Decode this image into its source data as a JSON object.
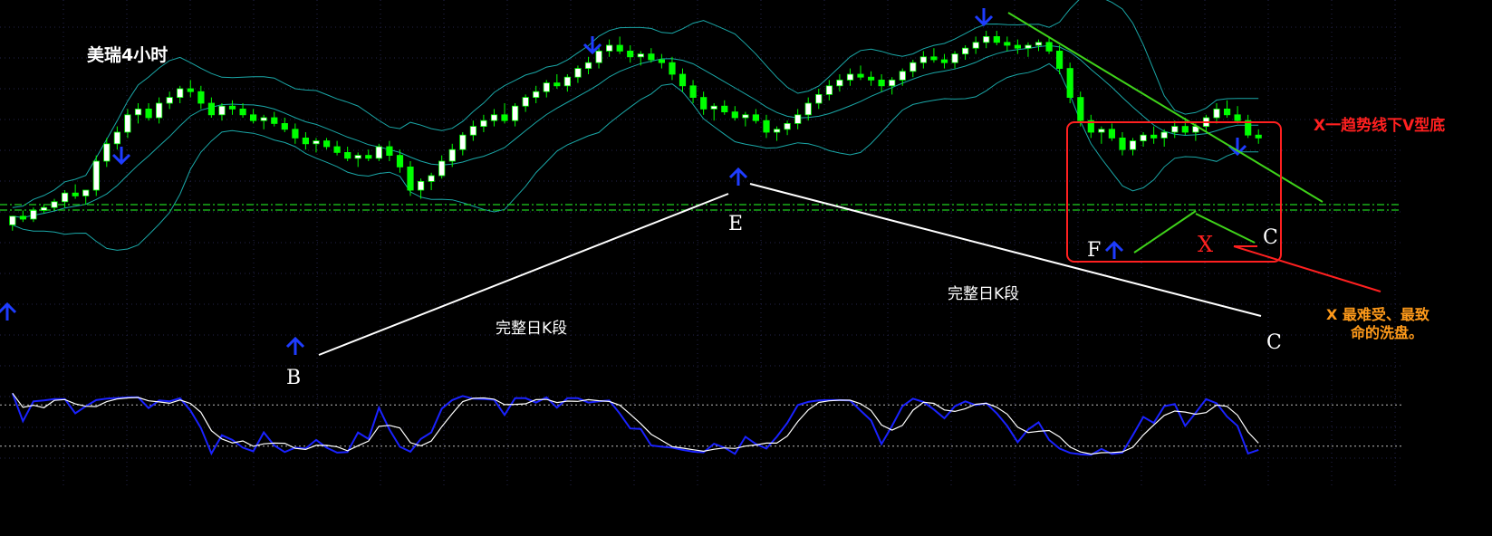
{
  "title": "美瑞4小时",
  "labels": {
    "B": "B",
    "E": "E",
    "F": "F",
    "C1": "C",
    "C2": "C",
    "X": "X",
    "seg1": "完整日K段",
    "seg2": "完整日K段",
    "note1": "X一趋势线下V型底",
    "note2_a": "X 最难受、最致",
    "note2_b": "命的洗盘。"
  },
  "colors": {
    "background": "#000000",
    "bull": "#ffffff",
    "bull_border": "#00ff00",
    "bear": "#00ff00",
    "band": "#1aa7a7",
    "arrow": "#1e3cff",
    "trend": "#3fd21a",
    "white_line": "#ffffff",
    "red": "#ff2020",
    "orange": "#ff9a1a",
    "stoch_k": "#1a22ff",
    "stoch_d": "#ffffff",
    "hline": "#1fcf1f",
    "grid": "#23234a"
  },
  "chart_data": {
    "type": "candlestick",
    "title": "美瑞4小时",
    "price_range": [
      0,
      100
    ],
    "stoch_range": [
      0,
      100
    ],
    "stoch_levels": [
      80,
      20
    ],
    "grid": true,
    "candles_approx": [
      [
        28,
        31,
        26,
        31
      ],
      [
        31,
        33,
        29,
        30
      ],
      [
        30,
        34,
        29,
        33
      ],
      [
        33,
        35,
        32,
        34
      ],
      [
        34,
        37,
        33,
        36
      ],
      [
        36,
        40,
        34,
        39
      ],
      [
        39,
        42,
        37,
        38
      ],
      [
        38,
        40,
        35,
        40
      ],
      [
        40,
        52,
        38,
        50
      ],
      [
        50,
        58,
        48,
        56
      ],
      [
        56,
        62,
        54,
        60
      ],
      [
        60,
        68,
        58,
        66
      ],
      [
        66,
        70,
        63,
        68
      ],
      [
        68,
        70,
        64,
        65
      ],
      [
        65,
        72,
        63,
        70
      ],
      [
        70,
        74,
        68,
        72
      ],
      [
        72,
        76,
        70,
        75
      ],
      [
        75,
        78,
        72,
        74
      ],
      [
        74,
        76,
        68,
        70
      ],
      [
        70,
        72,
        65,
        66
      ],
      [
        66,
        70,
        64,
        69
      ],
      [
        69,
        71,
        66,
        68
      ],
      [
        68,
        70,
        65,
        66
      ],
      [
        66,
        68,
        63,
        64
      ],
      [
        64,
        66,
        61,
        65
      ],
      [
        65,
        67,
        62,
        63
      ],
      [
        63,
        65,
        60,
        61
      ],
      [
        61,
        63,
        56,
        58
      ],
      [
        58,
        60,
        54,
        56
      ],
      [
        56,
        58,
        53,
        57
      ],
      [
        57,
        58,
        54,
        55
      ],
      [
        55,
        57,
        52,
        53
      ],
      [
        53,
        55,
        50,
        51
      ],
      [
        51,
        53,
        48,
        52
      ],
      [
        52,
        54,
        50,
        51
      ],
      [
        51,
        56,
        50,
        55
      ],
      [
        55,
        57,
        50,
        52
      ],
      [
        52,
        54,
        46,
        48
      ],
      [
        48,
        50,
        38,
        40
      ],
      [
        40,
        44,
        37,
        43
      ],
      [
        43,
        46,
        40,
        45
      ],
      [
        45,
        52,
        44,
        50
      ],
      [
        50,
        56,
        48,
        54
      ],
      [
        54,
        60,
        52,
        59
      ],
      [
        59,
        64,
        57,
        62
      ],
      [
        62,
        66,
        60,
        64
      ],
      [
        64,
        68,
        62,
        66
      ],
      [
        66,
        70,
        63,
        64
      ],
      [
        64,
        70,
        62,
        69
      ],
      [
        69,
        73,
        67,
        72
      ],
      [
        72,
        76,
        70,
        74
      ],
      [
        74,
        78,
        72,
        77
      ],
      [
        77,
        80,
        75,
        76
      ],
      [
        76,
        80,
        74,
        79
      ],
      [
        79,
        83,
        77,
        82
      ],
      [
        82,
        86,
        80,
        84
      ],
      [
        84,
        90,
        82,
        88
      ],
      [
        88,
        92,
        86,
        90
      ],
      [
        90,
        93,
        87,
        88
      ],
      [
        88,
        90,
        84,
        86
      ],
      [
        86,
        88,
        83,
        87
      ],
      [
        87,
        89,
        84,
        85
      ],
      [
        85,
        87,
        82,
        84
      ],
      [
        84,
        86,
        78,
        80
      ],
      [
        80,
        82,
        74,
        76
      ],
      [
        76,
        78,
        70,
        72
      ],
      [
        72,
        74,
        66,
        68
      ],
      [
        68,
        70,
        64,
        69
      ],
      [
        69,
        71,
        66,
        67
      ],
      [
        67,
        69,
        64,
        65
      ],
      [
        65,
        67,
        62,
        66
      ],
      [
        66,
        68,
        63,
        64
      ],
      [
        64,
        66,
        58,
        60
      ],
      [
        60,
        62,
        57,
        61
      ],
      [
        61,
        64,
        59,
        63
      ],
      [
        63,
        68,
        61,
        66
      ],
      [
        66,
        72,
        64,
        70
      ],
      [
        70,
        75,
        68,
        73
      ],
      [
        73,
        78,
        71,
        76
      ],
      [
        76,
        80,
        74,
        78
      ],
      [
        78,
        82,
        76,
        80
      ],
      [
        80,
        83,
        78,
        79
      ],
      [
        79,
        81,
        76,
        78
      ],
      [
        78,
        80,
        74,
        76
      ],
      [
        76,
        79,
        73,
        78
      ],
      [
        78,
        82,
        76,
        81
      ],
      [
        81,
        85,
        79,
        84
      ],
      [
        84,
        88,
        82,
        86
      ],
      [
        86,
        89,
        84,
        85
      ],
      [
        85,
        87,
        82,
        84
      ],
      [
        84,
        88,
        82,
        87
      ],
      [
        87,
        90,
        85,
        89
      ],
      [
        89,
        93,
        87,
        91
      ],
      [
        91,
        95,
        89,
        93
      ],
      [
        93,
        95,
        90,
        91
      ],
      [
        91,
        93,
        88,
        90
      ],
      [
        90,
        92,
        87,
        89
      ],
      [
        89,
        91,
        86,
        90
      ],
      [
        90,
        92,
        88,
        91
      ],
      [
        91,
        93,
        87,
        88
      ],
      [
        88,
        90,
        80,
        82
      ],
      [
        82,
        84,
        70,
        72
      ],
      [
        72,
        74,
        62,
        64
      ],
      [
        64,
        66,
        58,
        60
      ],
      [
        60,
        62,
        56,
        61
      ],
      [
        61,
        63,
        57,
        58
      ],
      [
        58,
        60,
        52,
        54
      ],
      [
        54,
        58,
        52,
        57
      ],
      [
        57,
        60,
        55,
        59
      ],
      [
        59,
        62,
        56,
        58
      ],
      [
        58,
        61,
        55,
        60
      ],
      [
        60,
        64,
        58,
        62
      ],
      [
        62,
        65,
        59,
        60
      ],
      [
        60,
        63,
        57,
        62
      ],
      [
        62,
        66,
        60,
        65
      ],
      [
        65,
        70,
        63,
        68
      ],
      [
        68,
        71,
        65,
        66
      ],
      [
        66,
        69,
        63,
        64
      ],
      [
        64,
        66,
        58,
        59
      ],
      [
        59,
        61,
        56,
        58
      ]
    ]
  }
}
